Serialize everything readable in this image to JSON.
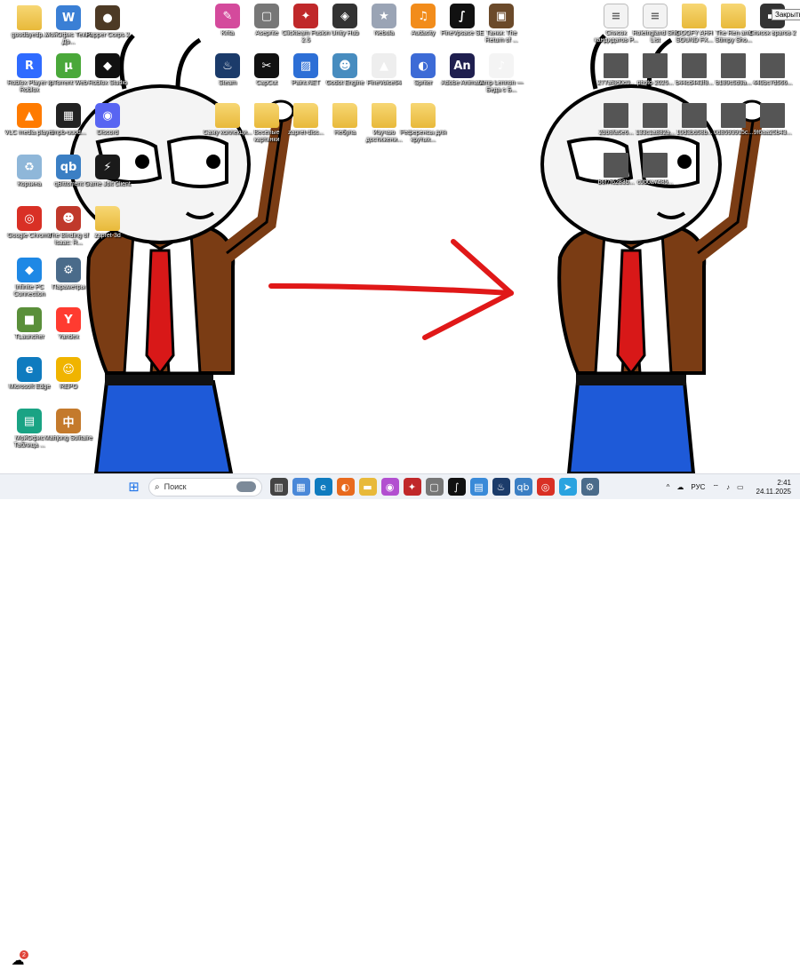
{
  "desktop": {
    "icons": [
      {
        "id": "goodbye",
        "label": "goodbyedp...",
        "glyph": "",
        "color": "#e8b93a",
        "kind": "folder"
      },
      {
        "id": "office",
        "label": "МойОфис Текст. До...",
        "glyph": "W",
        "color": "#3a7fd5",
        "kind": "app"
      },
      {
        "id": "corps",
        "label": "Papper Corps 2",
        "glyph": "●",
        "color": "#4d3a25",
        "kind": "app"
      },
      {
        "id": "roblox-player",
        "label": "Roblox Player и Roblox",
        "glyph": "R",
        "color": "#2f6bff",
        "kind": "app"
      },
      {
        "id": "utorrent",
        "label": "µTorrent Web",
        "glyph": "µ",
        "color": "#4aa83a",
        "kind": "app"
      },
      {
        "id": "roblox-studio",
        "label": "Roblox Studio",
        "glyph": "◆",
        "color": "#111111",
        "kind": "app"
      },
      {
        "id": "vlc",
        "label": "VLC media player",
        "glyph": "▲",
        "color": "#ff7b00",
        "kind": "app"
      },
      {
        "id": "tmpb",
        "label": "tmpb-uuod...",
        "glyph": "▦",
        "color": "#222222",
        "kind": "app"
      },
      {
        "id": "discord",
        "label": "Discord",
        "glyph": "◉",
        "color": "#5865f2",
        "kind": "app"
      },
      {
        "id": "recycle",
        "label": "Корзина",
        "glyph": "♻",
        "color": "#8fb7d9",
        "kind": "app"
      },
      {
        "id": "qbittorrent",
        "label": "qBittorrent",
        "glyph": "qb",
        "color": "#3b7fc4",
        "kind": "app"
      },
      {
        "id": "gamejolt",
        "label": "Game Jolt Client",
        "glyph": "⚡",
        "color": "#1a1a1a",
        "kind": "app"
      },
      {
        "id": "chrome",
        "label": "Google Chrome",
        "glyph": "◎",
        "color": "#d93025",
        "kind": "app"
      },
      {
        "id": "isaac",
        "label": "The Binding of Isaac: R...",
        "glyph": "☻",
        "color": "#c0392b",
        "kind": "app"
      },
      {
        "id": "zapret",
        "label": "zapret-3d",
        "glyph": "",
        "color": "#e8b93a",
        "kind": "folder"
      },
      {
        "id": "infinite",
        "label": "Infinite PC Connection",
        "glyph": "◆",
        "color": "#1e88e5",
        "kind": "app"
      },
      {
        "id": "params",
        "label": "Параметры",
        "glyph": "⚙",
        "color": "#4a6b8a",
        "kind": "app"
      },
      {
        "id": "tlauncher",
        "label": "TLauncher",
        "glyph": "■",
        "color": "#5a8f3a",
        "kind": "app"
      },
      {
        "id": "yandex",
        "label": "Yandex",
        "glyph": "Y",
        "color": "#ff3b30",
        "kind": "app"
      },
      {
        "id": "edge",
        "label": "Microsoft Edge",
        "glyph": "e",
        "color": "#0f7bbf",
        "kind": "app"
      },
      {
        "id": "repo",
        "label": "REPO",
        "glyph": "☺",
        "color": "#f0b400",
        "kind": "app"
      },
      {
        "id": "moyoffice-tab",
        "label": "МойОфис Таблица ...",
        "glyph": "▤",
        "color": "#1aa384",
        "kind": "app"
      },
      {
        "id": "mahjong",
        "label": "Mahjong Solitaire",
        "glyph": "中",
        "color": "#c47a2c",
        "kind": "app"
      },
      {
        "id": "krita",
        "label": "Krita",
        "glyph": "✎",
        "color": "#d44a9c",
        "kind": "app"
      },
      {
        "id": "aseprite",
        "label": "Aseprite",
        "glyph": "▢",
        "color": "#777777",
        "kind": "app"
      },
      {
        "id": "clickteam",
        "label": "Clickteam Fusion 2.5",
        "glyph": "✦",
        "color": "#c0282a",
        "kind": "app"
      },
      {
        "id": "unityhub",
        "label": "Unity Hub",
        "glyph": "◈",
        "color": "#333333",
        "kind": "app"
      },
      {
        "id": "nebula",
        "label": "Nebula",
        "glyph": "★",
        "color": "#9aa4b5",
        "kind": "app"
      },
      {
        "id": "audacity",
        "label": "Audacity",
        "glyph": "♫",
        "color": "#f28c1b",
        "kind": "app"
      },
      {
        "id": "flstudio",
        "label": "FineVpsace SE",
        "glyph": "∫",
        "color": "#111111",
        "kind": "app"
      },
      {
        "id": "terraria",
        "label": "Танки: The Return of ...",
        "glyph": "▣",
        "color": "#6b4a2a",
        "kind": "app"
      },
      {
        "id": "steam",
        "label": "Steam",
        "glyph": "♨",
        "color": "#1b3b6a",
        "kind": "app"
      },
      {
        "id": "capcut",
        "label": "CapCut",
        "glyph": "✂",
        "color": "#111111",
        "kind": "app"
      },
      {
        "id": "paintnet",
        "label": "Paint.NET",
        "glyph": "▨",
        "color": "#2d6fd6",
        "kind": "app"
      },
      {
        "id": "godot",
        "label": "Godot Engine",
        "glyph": "☻",
        "color": "#478cbf",
        "kind": "app"
      },
      {
        "id": "finevoice",
        "label": "FineVoice64",
        "glyph": "▲",
        "color": "#eeeeee",
        "kind": "app"
      },
      {
        "id": "spriter",
        "label": "Spriter",
        "glyph": "◐",
        "color": "#3d6bd6",
        "kind": "app"
      },
      {
        "id": "animate",
        "label": "Adobe Animate",
        "glyph": "An",
        "color": "#1f1f4f",
        "kind": "app"
      },
      {
        "id": "amp",
        "label": "Amp Lennon — Беда с Б...",
        "glyph": "♪",
        "color": "#f4f4f4",
        "kind": "app"
      },
      {
        "id": "samu",
        "label": "Саму коллекци...",
        "glyph": "",
        "color": "#e8b93a",
        "kind": "folder"
      },
      {
        "id": "veselye",
        "label": "Весёлые картинки",
        "glyph": "",
        "color": "#e8b93a",
        "kind": "folder"
      },
      {
        "id": "zapret-disc",
        "label": "zapret-disc...",
        "glyph": "",
        "color": "#e8b93a",
        "kind": "folder"
      },
      {
        "id": "nebula-folder",
        "label": "Небула",
        "glyph": "",
        "color": "#e8b93a",
        "kind": "folder"
      },
      {
        "id": "izuchaj",
        "label": "Изучаю достижени...",
        "glyph": "",
        "color": "#e8b93a",
        "kind": "folder"
      },
      {
        "id": "referensy",
        "label": "Референсы для крутых...",
        "glyph": "",
        "color": "#e8b93a",
        "kind": "folder"
      },
      {
        "id": "spisok-kand",
        "label": "Список кандидатов P...",
        "glyph": "≡",
        "color": "#f3f3f3",
        "kind": "doc"
      },
      {
        "id": "roleingland",
        "label": "Roleingland Shit List",
        "glyph": "≡",
        "color": "#f3f3f3",
        "kind": "doc"
      },
      {
        "id": "goofy",
        "label": "GOOFY AHH SOUND FX...",
        "glyph": "",
        "color": "#e8b93a",
        "kind": "folder"
      },
      {
        "id": "ren-stimpy",
        "label": "The Ren and Stimpy Sho...",
        "glyph": "",
        "color": "#e8b93a",
        "kind": "folder"
      },
      {
        "id": "spisok-vrag",
        "label": "Список врагов 2",
        "glyph": "▬",
        "color": "#333333",
        "kind": "app"
      },
      {
        "id": "t1",
        "label": "277af8d0c0...",
        "glyph": "",
        "color": "#3b2b4a",
        "kind": "thumb"
      },
      {
        "id": "t2",
        "label": "photo 2025...",
        "glyph": "",
        "color": "#5a5a6a",
        "kind": "thumb"
      },
      {
        "id": "t3",
        "label": "b44cd443f8...",
        "glyph": "",
        "color": "#6a4a7a",
        "kind": "thumb"
      },
      {
        "id": "t4",
        "label": "b189c5d9a...",
        "glyph": "",
        "color": "#2a2a2a",
        "kind": "thumb"
      },
      {
        "id": "t5",
        "label": "440bc7d566...",
        "glyph": "",
        "color": "#4a4a4a",
        "kind": "thumb"
      },
      {
        "id": "t6",
        "label": "2bb8fa5e6...",
        "glyph": "",
        "color": "#dddddd",
        "kind": "thumb"
      },
      {
        "id": "t7",
        "label": "133c1a882a...",
        "glyph": "",
        "color": "#c9b070",
        "kind": "thumb"
      },
      {
        "id": "t8",
        "label": "10d3bd58b...",
        "glyph": "",
        "color": "#7a4a3a",
        "kind": "thumb"
      },
      {
        "id": "t9",
        "label": "0d8593915c...",
        "glyph": "",
        "color": "#b84040",
        "kind": "thumb"
      },
      {
        "id": "t10",
        "label": "9f6aa25b43...",
        "glyph": "",
        "color": "#d9c7b0",
        "kind": "thumb"
      },
      {
        "id": "t11",
        "label": "b6f7f6283b...",
        "glyph": "",
        "color": "#8a3a2a",
        "kind": "thumb"
      },
      {
        "id": "t12",
        "label": "c0b0a7d85...",
        "glyph": "",
        "color": "#c8a070",
        "kind": "thumb"
      }
    ],
    "tooltip": "Закрыть"
  },
  "taskbar": {
    "weather_badge": "2",
    "search_placeholder": "Поиск",
    "pinned": [
      {
        "id": "start",
        "glyph": "⊞",
        "color": "#1e73e8"
      },
      {
        "id": "taskview",
        "glyph": "▥",
        "color": "#444444"
      },
      {
        "id": "widgets",
        "glyph": "▦",
        "color": "#4a88d8"
      },
      {
        "id": "edge",
        "glyph": "e",
        "color": "#0f7bbf"
      },
      {
        "id": "firefox",
        "glyph": "◐",
        "color": "#e86a1e"
      },
      {
        "id": "explorer",
        "glyph": "▬",
        "color": "#e8b93a"
      },
      {
        "id": "app-multi",
        "glyph": "◉",
        "color": "#b24fd0"
      },
      {
        "id": "clickteam",
        "glyph": "✦",
        "color": "#c0282a"
      },
      {
        "id": "aseprite",
        "glyph": "▢",
        "color": "#777777"
      },
      {
        "id": "flstudio",
        "glyph": "∫",
        "color": "#111111"
      },
      {
        "id": "app-blue",
        "glyph": "▤",
        "color": "#3a8ad8"
      },
      {
        "id": "steam",
        "glyph": "♨",
        "color": "#1b3b6a"
      },
      {
        "id": "qbittorrent",
        "glyph": "qb",
        "color": "#3b7fc4"
      },
      {
        "id": "chrome",
        "glyph": "◎",
        "color": "#d93025"
      },
      {
        "id": "telegram",
        "glyph": "➤",
        "color": "#2aa3e0"
      },
      {
        "id": "settings",
        "glyph": "⚙",
        "color": "#4a6b8a"
      }
    ],
    "tray": {
      "chevron": "^",
      "language": "РУС",
      "time": "2:41",
      "date": "24.11.2025"
    }
  },
  "colors": {
    "arrow": "#e01818",
    "jacket": "#7a3c14",
    "tie": "#d81818",
    "pants": "#1e5ad8"
  }
}
